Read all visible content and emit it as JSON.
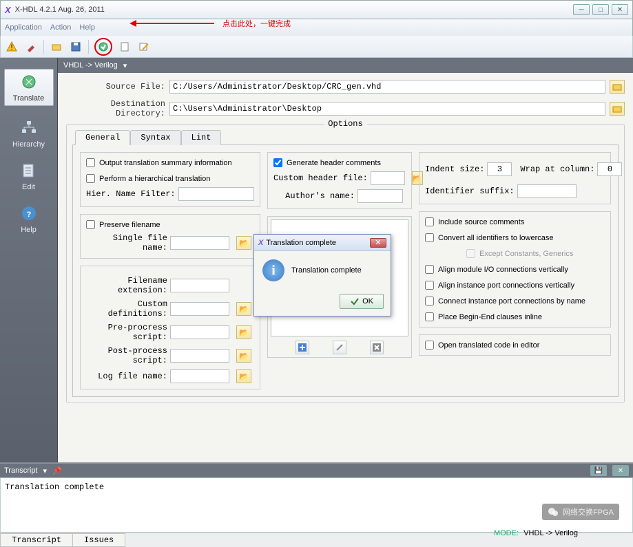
{
  "window": {
    "title": "X-HDL 4.2.1  Aug. 26, 2011"
  },
  "menu": {
    "application": "Application",
    "action": "Action",
    "help": "Help"
  },
  "annotation": "点击此处，一键完成",
  "sidebar": {
    "translate": "Translate",
    "hierarchy": "Hierarchy",
    "edit": "Edit",
    "help": "Help"
  },
  "modebar": {
    "mode": "VHDL -> Verilog"
  },
  "form": {
    "source_label": "Source File:",
    "source_value": "C:/Users/Administrator/Desktop/CRC_gen.vhd",
    "dest_label": "Destination Directory:",
    "dest_value": "C:\\Users\\Administrator\\Desktop"
  },
  "options": {
    "legend": "Options",
    "tabs": {
      "general": "General",
      "syntax": "Syntax",
      "lint": "Lint"
    },
    "col1": {
      "output_summary": "Output translation summary information",
      "perform_hier": "Perform a hierarchical translation",
      "hier_filter": "Hier. Name Filter:",
      "preserve_filename": "Preserve filename",
      "single_file": "Single file name:",
      "file_ext": "Filename extension:",
      "custom_def": "Custom definitions:",
      "pre_script": "Pre-procress script:",
      "post_script": "Post-process script:",
      "log_file": "Log file name:"
    },
    "col2": {
      "gen_header": "Generate header comments",
      "gen_header_checked": true,
      "custom_header": "Custom header file:",
      "author": "Author's name:"
    },
    "col3": {
      "indent_label": "Indent size:",
      "indent_value": "3",
      "wrap_label": "Wrap at column:",
      "wrap_value": "0",
      "id_suffix": "Identifier suffix:",
      "include_src": "Include source comments",
      "convert_lower": "Convert all identifiers to lowercase",
      "except_const": "Except Constants, Generics",
      "align_io": "Align module I/O connections vertically",
      "align_inst": "Align instance port connections vertically",
      "connect_name": "Connect instance port connections by name",
      "begin_end": "Place Begin-End clauses inline",
      "open_editor": "Open translated code in editor"
    }
  },
  "dialog": {
    "title": "Translation complete",
    "message": "Translation complete",
    "ok": "OK"
  },
  "transcript": {
    "title": "Transcript",
    "body": "Translation complete",
    "tab1": "Transcript",
    "tab2": "Issues"
  },
  "statusbar": {
    "mode": "MODE: VHDL -> Verilog"
  },
  "watermark": "网络交换FPGA"
}
